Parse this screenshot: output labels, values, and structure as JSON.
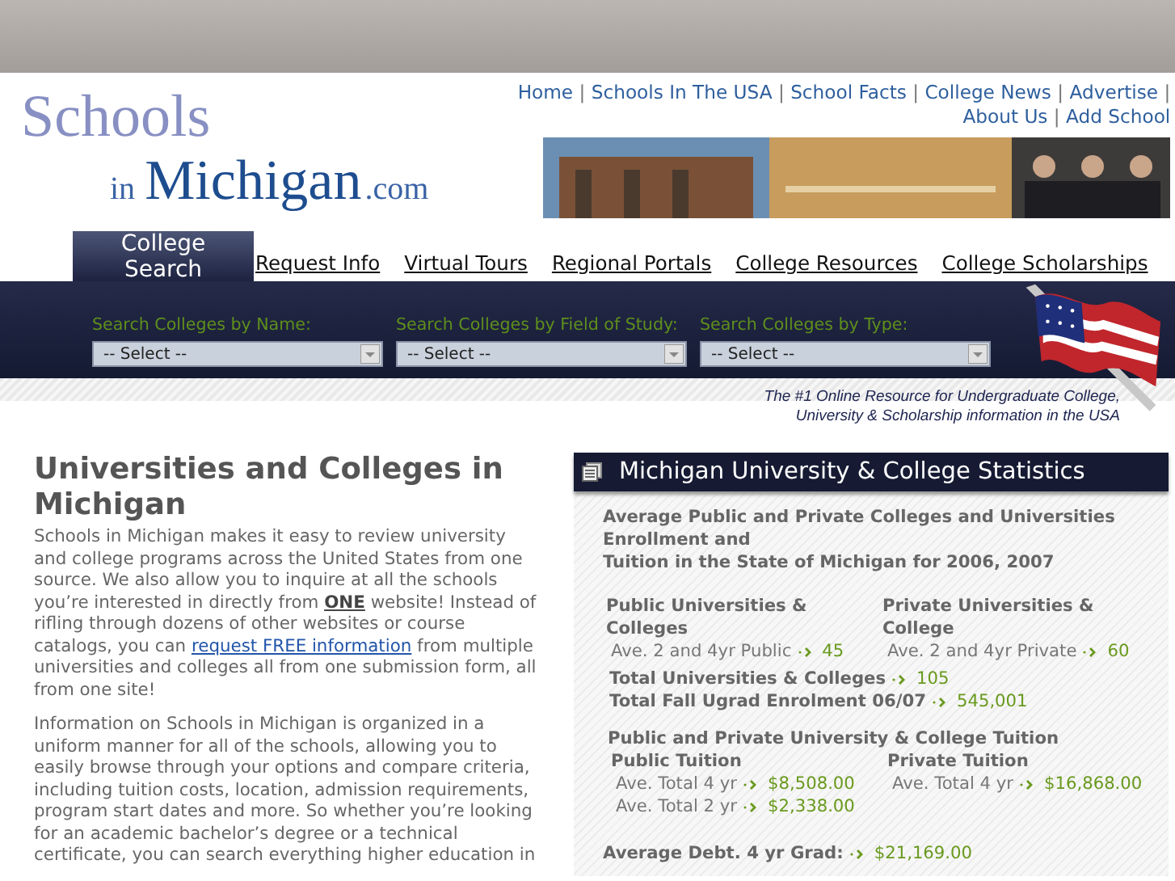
{
  "top_nav": [
    {
      "kind": "link",
      "label": "Home"
    },
    {
      "kind": "separator",
      "label": "|"
    },
    {
      "kind": "link",
      "label": "Schools In The USA"
    },
    {
      "kind": "separator",
      "label": "|"
    },
    {
      "kind": "link",
      "label": "School Facts"
    },
    {
      "kind": "separator",
      "label": "|"
    },
    {
      "kind": "link",
      "label": "College News"
    },
    {
      "kind": "separator",
      "label": "|"
    },
    {
      "kind": "link",
      "label": "Advertise"
    },
    {
      "kind": "separator",
      "label": "|"
    },
    {
      "kind": "link",
      "label": "About Us"
    },
    {
      "kind": "separator",
      "label": "|"
    },
    {
      "kind": "link",
      "label": "Add School"
    }
  ],
  "logo": {
    "word1": "Schools",
    "small": "in",
    "word2": "Michigan",
    "suffix": ".com"
  },
  "banner": {
    "kind": "picture"
  },
  "tabs": [
    {
      "label": "College Search",
      "selected": true
    },
    {
      "label": "Request Info",
      "selected": false
    },
    {
      "label": "Virtual Tours",
      "selected": false
    },
    {
      "label": "Regional Portals",
      "selected": false
    },
    {
      "label": "College Resources",
      "selected": false
    },
    {
      "label": "College Scholarships",
      "selected": false
    }
  ],
  "search": [
    {
      "label": "Search Colleges by Name:",
      "value": "-- Select --"
    },
    {
      "label": "Search Colleges by Field of Study:",
      "value": "-- Select --"
    },
    {
      "label": "Search Colleges by Type:",
      "value": "-- Select --"
    }
  ],
  "tagline": [
    "The #1 Online Resource for Undergraduate College,",
    "University & Scholarship information in the USA"
  ],
  "article": {
    "title": "Universities and Colleges in Michigan",
    "intro": {
      "before": "Schools in Michigan makes it easy to review university and college programs across the United States from one source.  We also allow you to inquire at all the schools you’re interested in directly from **ONE** website! Instead of rifling through dozens of other websites or course catalogs, you can",
      "link": "request FREE information",
      "after": " from multiple universities and colleges all from one submission form, all from one site!"
    },
    "paragraphs": [
      "Information on Schools in Michigan is organized in a uniform manner for all of the schools, allowing you to easily browse through your options and compare criteria, including tuition costs, location, admission requirements, program start dates and more. So whether you’re looking for an academic bachelor’s degree or a technical certificate, you can search everything higher education in"
    ]
  },
  "stats": {
    "title": "Michigan University & College Statistics",
    "intro_lines": [
      "Average Public and Private Colleges and Universities Enrollment and",
      "Tuition in the State of Michigan for 2006, 2007"
    ],
    "counts": [
      {
        "heading": "Public Universities & Colleges",
        "rows": [
          {
            "label": "Ave. 2 and 4yr Public",
            "value": "45"
          }
        ]
      },
      {
        "heading": "Private Universities & College",
        "rows": [
          {
            "label": "Ave. 2 and 4yr Private",
            "value": "60"
          }
        ]
      }
    ],
    "totals": [
      {
        "label": "Total Universities & Colleges",
        "value": "105"
      },
      {
        "label": "Total Fall Ugrad Enrolment 06/07",
        "value": "545,001"
      }
    ],
    "tuition_heading": "Public and Private University & College Tuition",
    "tuition": [
      {
        "heading": "Public Tuition",
        "rows": [
          {
            "label": "Ave. Total 4 yr",
            "value": "$8,508.00"
          },
          {
            "label": "Ave. Total 2 yr",
            "value": "$2,338.00"
          }
        ]
      },
      {
        "heading": "Private Tuition",
        "rows": [
          {
            "label": "Ave. Total 4 yr",
            "value": "$16,868.00"
          }
        ]
      }
    ],
    "debt": {
      "label": "Average Debt. 4 yr Grad:",
      "value": "$21,169.00"
    }
  }
}
